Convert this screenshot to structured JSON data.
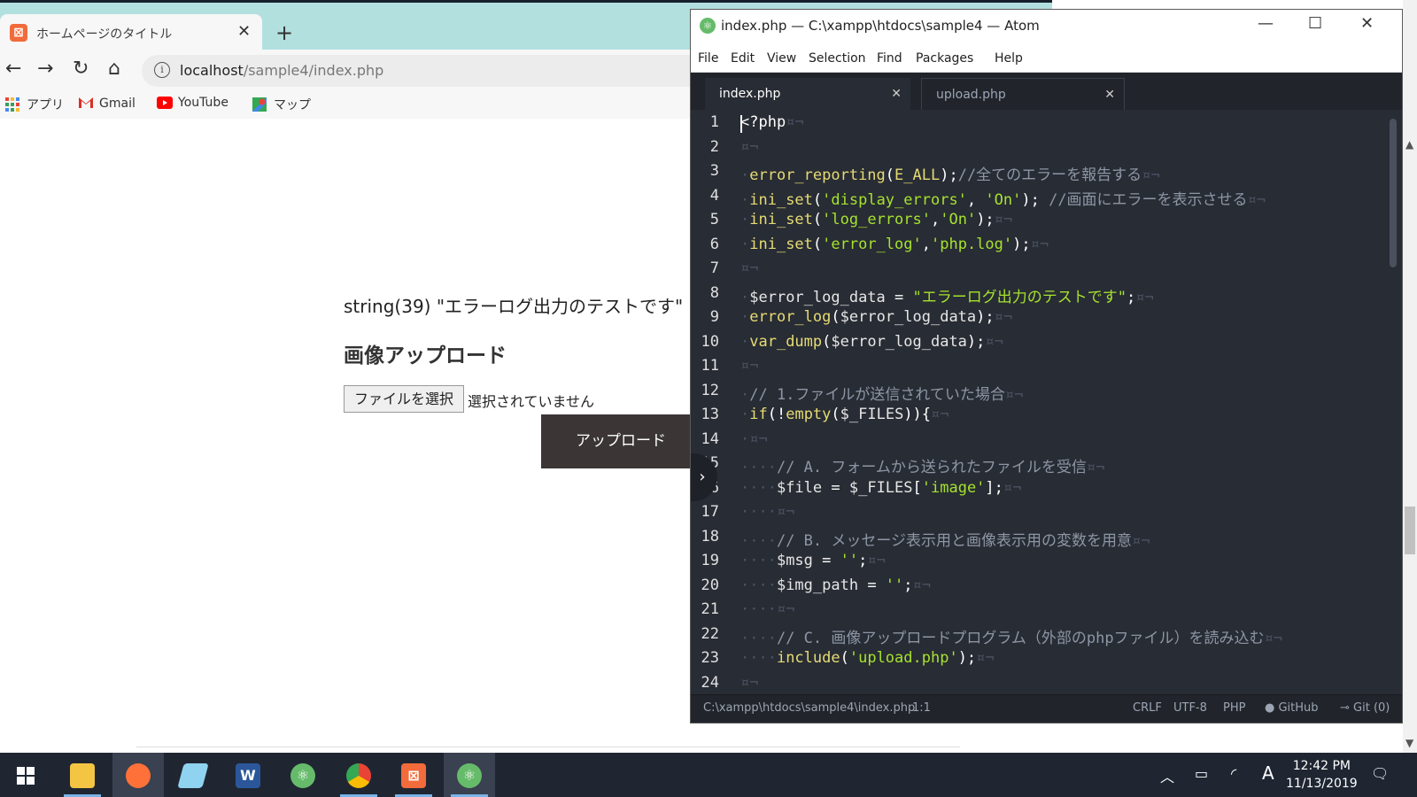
{
  "browser": {
    "tab_title": "ホームページのタイトル",
    "tab_close": "✕",
    "new_tab": "+",
    "url_host": "localhost",
    "url_path": "/sample4/index.php",
    "bookmarks": [
      "アプリ",
      "Gmail",
      "YouTube",
      "マップ"
    ],
    "page": {
      "dump_line": "string(39) \"エラーログ出力のテストです\"",
      "heading": "画像アップロード",
      "file_button": "ファイルを選択",
      "file_status": "選択されていません",
      "upload_button": "アップロード"
    }
  },
  "atom": {
    "title": "index.php — C:\\xampp\\htdocs\\sample4 — Atom",
    "menu": [
      "File",
      "Edit",
      "View",
      "Selection",
      "Find",
      "Packages",
      "Help"
    ],
    "tabs": [
      {
        "label": "index.php",
        "active": true
      },
      {
        "label": "upload.php",
        "active": false
      }
    ],
    "lines": [
      {
        "n": "1",
        "segs": [
          [
            "op",
            "<?php"
          ],
          [
            "inv",
            "¤¬"
          ]
        ]
      },
      {
        "n": "2",
        "segs": [
          [
            "inv",
            "¤¬"
          ]
        ]
      },
      {
        "n": "3",
        "segs": [
          [
            "inv",
            "·"
          ],
          [
            "fn",
            "error_reporting"
          ],
          [
            "op",
            "("
          ],
          [
            "fn",
            "E_ALL"
          ],
          [
            "op",
            ");"
          ],
          [
            "cm",
            "//全てのエラーを報告する"
          ],
          [
            "inv",
            "¤¬"
          ]
        ]
      },
      {
        "n": "4",
        "segs": [
          [
            "inv",
            "·"
          ],
          [
            "fn",
            "ini_set"
          ],
          [
            "op",
            "("
          ],
          [
            "str",
            "'display_errors'"
          ],
          [
            "op",
            ", "
          ],
          [
            "str",
            "'On'"
          ],
          [
            "op",
            "); "
          ],
          [
            "cm",
            "//画面にエラーを表示させる"
          ],
          [
            "inv",
            "¤¬"
          ]
        ]
      },
      {
        "n": "5",
        "segs": [
          [
            "inv",
            "·"
          ],
          [
            "fn",
            "ini_set"
          ],
          [
            "op",
            "("
          ],
          [
            "str",
            "'log_errors'"
          ],
          [
            "op",
            ","
          ],
          [
            "str",
            "'On'"
          ],
          [
            "op",
            ");"
          ],
          [
            "inv",
            "¤¬"
          ]
        ]
      },
      {
        "n": "6",
        "segs": [
          [
            "inv",
            "·"
          ],
          [
            "fn",
            "ini_set"
          ],
          [
            "op",
            "("
          ],
          [
            "str",
            "'error_log'"
          ],
          [
            "op",
            ","
          ],
          [
            "str",
            "'php.log'"
          ],
          [
            "op",
            ");"
          ],
          [
            "inv",
            "¤¬"
          ]
        ]
      },
      {
        "n": "7",
        "segs": [
          [
            "inv",
            "¤¬"
          ]
        ]
      },
      {
        "n": "8",
        "segs": [
          [
            "inv",
            "·"
          ],
          [
            "var",
            "$error_log_data"
          ],
          [
            "op",
            " = "
          ],
          [
            "str",
            "\"エラーログ出力のテストです\""
          ],
          [
            "op",
            ";"
          ],
          [
            "inv",
            "¤¬"
          ]
        ]
      },
      {
        "n": "9",
        "segs": [
          [
            "inv",
            "·"
          ],
          [
            "fn",
            "error_log"
          ],
          [
            "op",
            "("
          ],
          [
            "var",
            "$error_log_data"
          ],
          [
            "op",
            ");"
          ],
          [
            "inv",
            "¤¬"
          ]
        ]
      },
      {
        "n": "10",
        "segs": [
          [
            "inv",
            "·"
          ],
          [
            "fn",
            "var_dump"
          ],
          [
            "op",
            "("
          ],
          [
            "var",
            "$error_log_data"
          ],
          [
            "op",
            ");"
          ],
          [
            "inv",
            "¤¬"
          ]
        ]
      },
      {
        "n": "11",
        "segs": [
          [
            "inv",
            "¤¬"
          ]
        ]
      },
      {
        "n": "12",
        "segs": [
          [
            "inv",
            "·"
          ],
          [
            "cm",
            "// 1.ファイルが送信されていた場合"
          ],
          [
            "inv",
            "¤¬"
          ]
        ]
      },
      {
        "n": "13",
        "segs": [
          [
            "inv",
            "·"
          ],
          [
            "fn",
            "if"
          ],
          [
            "op",
            "(!"
          ],
          [
            "fn",
            "empty"
          ],
          [
            "op",
            "("
          ],
          [
            "var",
            "$_FILES"
          ],
          [
            "op",
            ")){"
          ],
          [
            "inv",
            "¤¬"
          ]
        ]
      },
      {
        "n": "14",
        "segs": [
          [
            "inv",
            "·¤¬"
          ]
        ]
      },
      {
        "n": "15",
        "segs": [
          [
            "inv",
            "····"
          ],
          [
            "cm",
            "// A. フォームから送られたファイルを受信"
          ],
          [
            "inv",
            "¤¬"
          ]
        ]
      },
      {
        "n": "16",
        "segs": [
          [
            "inv",
            "····"
          ],
          [
            "var",
            "$file"
          ],
          [
            "op",
            " = "
          ],
          [
            "var",
            "$_FILES"
          ],
          [
            "op",
            "["
          ],
          [
            "str",
            "'image'"
          ],
          [
            "op",
            "];"
          ],
          [
            "inv",
            "¤¬"
          ]
        ]
      },
      {
        "n": "17",
        "segs": [
          [
            "inv",
            "····¤¬"
          ]
        ]
      },
      {
        "n": "18",
        "segs": [
          [
            "inv",
            "····"
          ],
          [
            "cm",
            "// B. メッセージ表示用と画像表示用の変数を用意"
          ],
          [
            "inv",
            "¤¬"
          ]
        ]
      },
      {
        "n": "19",
        "segs": [
          [
            "inv",
            "····"
          ],
          [
            "var",
            "$msg"
          ],
          [
            "op",
            " = "
          ],
          [
            "str",
            "''"
          ],
          [
            "op",
            ";"
          ],
          [
            "inv",
            "¤¬"
          ]
        ]
      },
      {
        "n": "20",
        "segs": [
          [
            "inv",
            "····"
          ],
          [
            "var",
            "$img_path"
          ],
          [
            "op",
            " = "
          ],
          [
            "str",
            "''"
          ],
          [
            "op",
            ";"
          ],
          [
            "inv",
            "¤¬"
          ]
        ]
      },
      {
        "n": "21",
        "segs": [
          [
            "inv",
            "····¤¬"
          ]
        ]
      },
      {
        "n": "22",
        "segs": [
          [
            "inv",
            "····"
          ],
          [
            "cm",
            "// C. 画像アップロードプログラム（外部のphpファイル）を読み込む"
          ],
          [
            "inv",
            "¤¬"
          ]
        ]
      },
      {
        "n": "23",
        "segs": [
          [
            "inv",
            "····"
          ],
          [
            "fn",
            "include"
          ],
          [
            "op",
            "("
          ],
          [
            "str",
            "'upload.php'"
          ],
          [
            "op",
            ");"
          ],
          [
            "inv",
            "¤¬"
          ]
        ]
      },
      {
        "n": "24",
        "segs": [
          [
            "inv",
            "¤¬"
          ]
        ]
      }
    ],
    "status": {
      "path": "C:\\xampp\\htdocs\\sample4\\index.php",
      "cursor": "1:1",
      "line_ending": "CRLF",
      "encoding": "UTF-8",
      "grammar": "PHP",
      "github": "GitHub",
      "git": "Git (0)"
    }
  },
  "taskbar": {
    "time": "12:42 PM",
    "date": "11/13/2019",
    "ime": "A"
  },
  "colors": {
    "atom_bg": "#282c34",
    "keyword_yellow": "#e6db74",
    "string_green": "#a6e22e",
    "comment_gray": "#8d96a5",
    "browser_tab_teal": "#b2e0df"
  }
}
